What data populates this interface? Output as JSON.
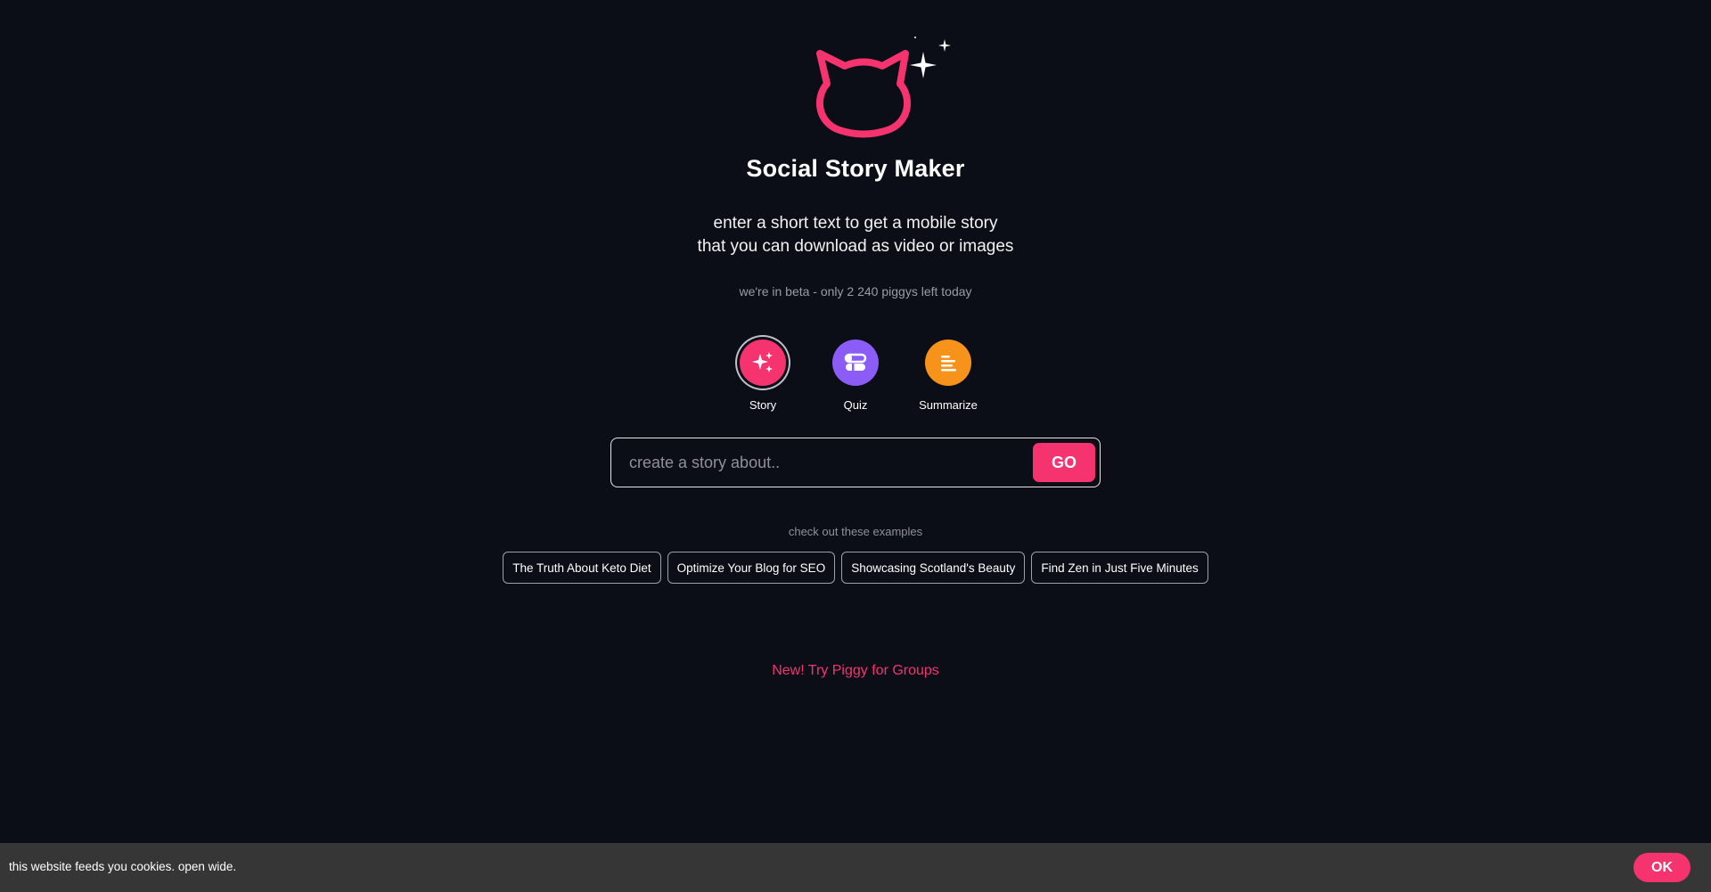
{
  "brand": {
    "logo_icon": "cat-face-icon",
    "sparkle_icon": "sparkles-icon",
    "accent_color": "#f4336f"
  },
  "hero": {
    "title": "Social Story Maker",
    "subtitle_line1": "enter a short text to get a mobile story",
    "subtitle_line2": "that you can download as video or images",
    "beta_notice": "we're in beta - only 2 240 piggys left today"
  },
  "modes": [
    {
      "label": "Story",
      "icon": "sparkles-icon",
      "color": "#f4336f",
      "selected": true
    },
    {
      "label": "Quiz",
      "icon": "toggle-list-icon",
      "color": "#8b5cf6",
      "selected": false
    },
    {
      "label": "Summarize",
      "icon": "text-align-left-icon",
      "color": "#f7931a",
      "selected": false
    }
  ],
  "search": {
    "placeholder": "create a story about..",
    "value": "",
    "go_label": "GO"
  },
  "examples": {
    "label": "check out these examples",
    "items": [
      "The Truth About Keto Diet",
      "Optimize Your Blog for SEO",
      "Showcasing Scotland's Beauty",
      "Find Zen in Just Five Minutes"
    ]
  },
  "groups_link": "New! Try Piggy for Groups",
  "cookie": {
    "text": "this website feeds you cookies. open wide.",
    "ok_label": "OK"
  }
}
